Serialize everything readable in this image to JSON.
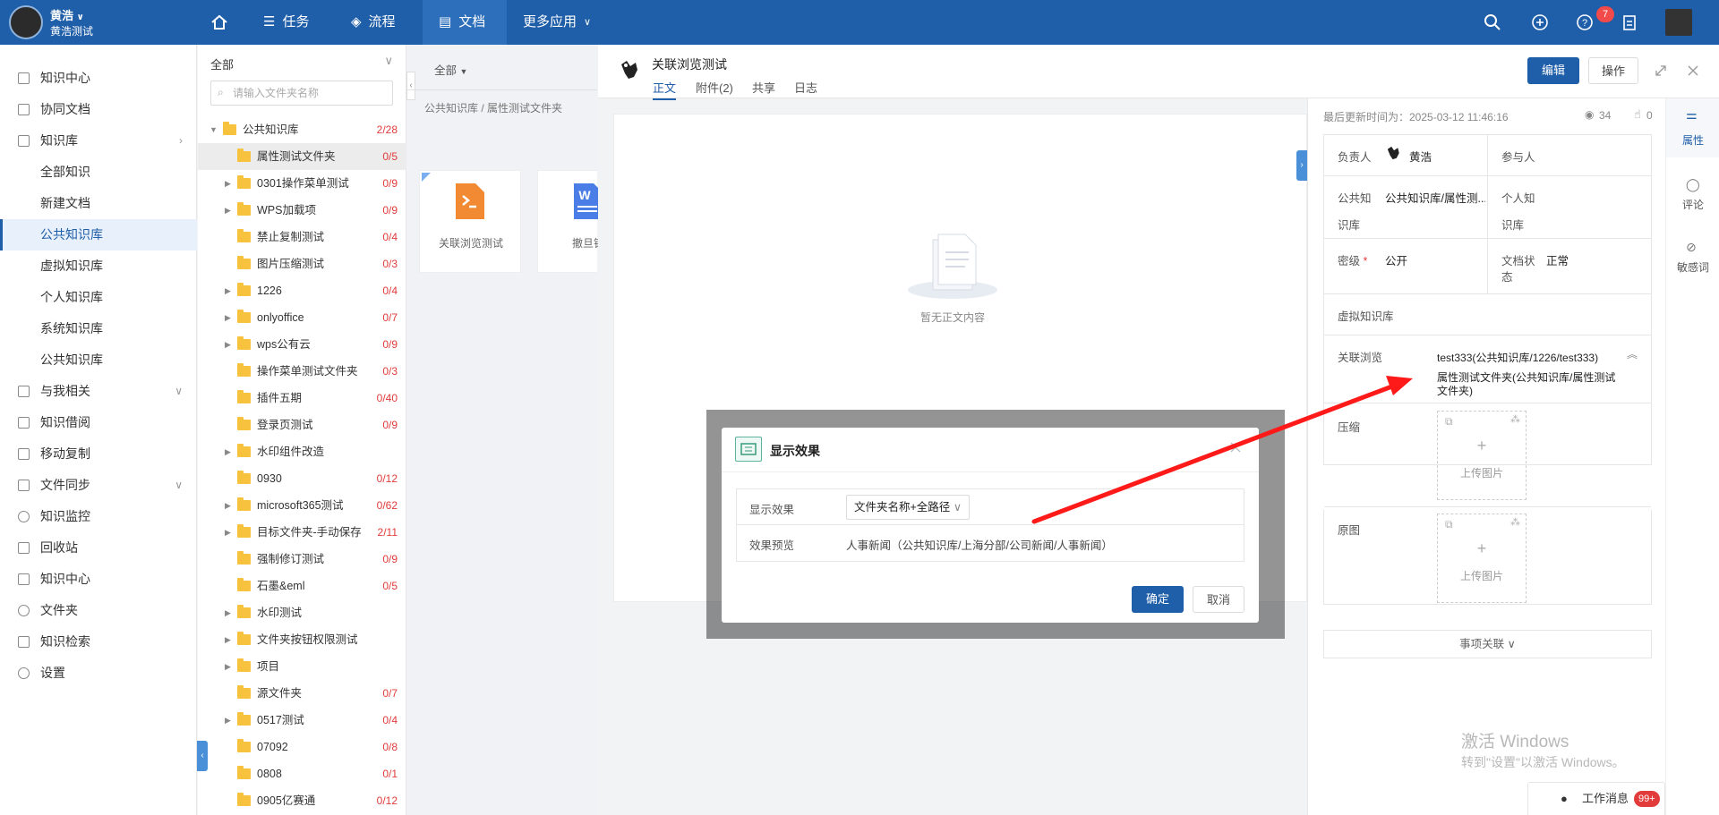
{
  "topbar": {
    "user_name": "黄浩",
    "user_org": "黄浩测试",
    "nav": [
      {
        "label": "任务"
      },
      {
        "label": "流程"
      },
      {
        "label": "文档"
      },
      {
        "label": "更多应用"
      }
    ],
    "notification_count": "7"
  },
  "sidebar": {
    "items": [
      {
        "label": "知识中心"
      },
      {
        "label": "协同文档"
      },
      {
        "label": "知识库"
      },
      {
        "label": "全部知识"
      },
      {
        "label": "新建文档"
      },
      {
        "label": "公共知识库"
      },
      {
        "label": "虚拟知识库"
      },
      {
        "label": "个人知识库"
      },
      {
        "label": "系统知识库"
      },
      {
        "label": "公共知识库"
      },
      {
        "label": "与我相关"
      },
      {
        "label": "知识借阅"
      },
      {
        "label": "移动复制"
      },
      {
        "label": "文件同步"
      },
      {
        "label": "知识监控"
      },
      {
        "label": "回收站"
      },
      {
        "label": "知识中心"
      },
      {
        "label": "文件夹"
      },
      {
        "label": "知识检索"
      },
      {
        "label": "设置"
      }
    ]
  },
  "tree": {
    "header": "全部",
    "search_placeholder": "请输入文件夹名称",
    "rows": [
      {
        "name": "公共知识库",
        "count": "2/28"
      },
      {
        "name": "属性测试文件夹",
        "count": "0/5"
      },
      {
        "name": "0301操作菜单测试",
        "count": "0/9"
      },
      {
        "name": "WPS加载项",
        "count": "0/9"
      },
      {
        "name": "禁止复制测试",
        "count": "0/4"
      },
      {
        "name": "图片压缩测试",
        "count": "0/3"
      },
      {
        "name": "1226",
        "count": "0/4"
      },
      {
        "name": "onlyoffice",
        "count": "0/7"
      },
      {
        "name": "wps公有云",
        "count": "0/9"
      },
      {
        "name": "操作菜单测试文件夹",
        "count": "0/3"
      },
      {
        "name": "插件五期",
        "count": "0/40"
      },
      {
        "name": "登录页测试",
        "count": "0/9"
      },
      {
        "name": "水印组件改造",
        "count": ""
      },
      {
        "name": "0930",
        "count": "0/12"
      },
      {
        "name": "microsoft365测试",
        "count": "0/62"
      },
      {
        "name": "目标文件夹-手动保存",
        "count": "2/11"
      },
      {
        "name": "强制修订测试",
        "count": "0/9"
      },
      {
        "name": "石墨&eml",
        "count": "0/5"
      },
      {
        "name": "水印测试",
        "count": ""
      },
      {
        "name": "文件夹按钮权限测试",
        "count": ""
      },
      {
        "name": "项目",
        "count": ""
      },
      {
        "name": "源文件夹",
        "count": "0/7"
      },
      {
        "name": "0517测试",
        "count": "0/4"
      },
      {
        "name": "07092",
        "count": "0/8"
      },
      {
        "name": "0808",
        "count": "0/1"
      },
      {
        "name": "0905亿赛通",
        "count": "0/12"
      }
    ]
  },
  "middle": {
    "filter_label": "全部",
    "breadcrumb": "公共知识库 / 属性测试文件夹",
    "cards": [
      {
        "name": "关联浏览测试"
      },
      {
        "name": "撤旦镇"
      }
    ]
  },
  "document": {
    "title": "关联浏览测试",
    "tabs": [
      {
        "label": "正文"
      },
      {
        "label": "附件(2)"
      },
      {
        "label": "共享"
      },
      {
        "label": "日志"
      }
    ],
    "empty_text": "暂无正文内容",
    "edit_button": "编辑",
    "action_button": "操作"
  },
  "properties": {
    "last_update": "最后更新时间为：2025-03-12 11:46:16",
    "views": "34",
    "likes": "0",
    "owner_label": "负责人",
    "owner_value": "黄浩",
    "participants_label": "参与人",
    "public_kb_label_1": "公共知",
    "public_kb_label_2": "识库",
    "public_kb_value": "公共知识库/属性测...",
    "personal_kb_label_1": "个人知",
    "personal_kb_label_2": "识库",
    "secret_label": "密级",
    "secret_value": "公开",
    "doc_status_label_1": "文档状",
    "doc_status_label_2": "态",
    "doc_status_value": "正常",
    "virtual_kb_label": "虚拟知识库",
    "related_label": "关联浏览",
    "related_value_1": "test333(公共知识库/1226/test333)",
    "related_value_2": "属性测试文件夹(公共知识库/属性测试文件夹)",
    "compress_label": "压缩",
    "original_label": "原图",
    "upload_label": "上传图片",
    "related_items": "事项关联"
  },
  "right_tabs": [
    {
      "label": "属性"
    },
    {
      "label": "评论"
    },
    {
      "label": "敏感词"
    }
  ],
  "modal": {
    "title": "显示效果",
    "row1_label": "显示效果",
    "row1_value": "文件夹名称+全路径",
    "row2_label": "效果预览",
    "row2_value": "人事新闻（公共知识库/上海分部/公司新闻/人事新闻）",
    "confirm": "确定",
    "cancel": "取消"
  },
  "watermark": {
    "line1": "激活 Windows",
    "line2": "转到\"设置\"以激活 Windows。"
  },
  "work_msg": {
    "label": "工作消息",
    "count": "99+"
  },
  "colors": {
    "brand": "#1f5ea8",
    "danger": "#e23b3b",
    "arrow": "#ff1a1a"
  }
}
